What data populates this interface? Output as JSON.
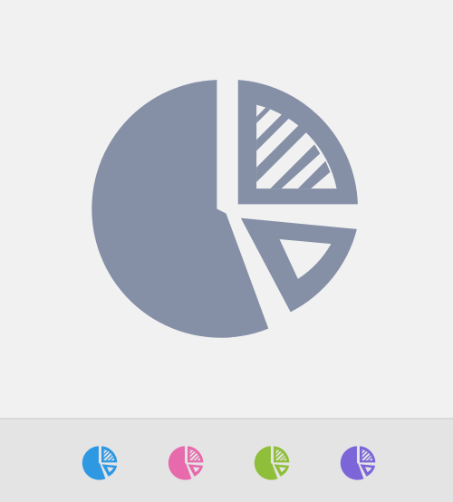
{
  "main_icon": {
    "name": "pie-chart-icon",
    "color": "#8590a7"
  },
  "variants": [
    {
      "name": "pie-chart-icon-blue",
      "color": "#2e98e3"
    },
    {
      "name": "pie-chart-icon-pink",
      "color": "#e76aac"
    },
    {
      "name": "pie-chart-icon-green",
      "color": "#8fbe3a"
    },
    {
      "name": "pie-chart-icon-purple",
      "color": "#7b65d9"
    }
  ],
  "colors": {
    "background": "#f1f1f1",
    "variant_bar": "#e4e4e4",
    "divider": "#d9d9d9"
  }
}
